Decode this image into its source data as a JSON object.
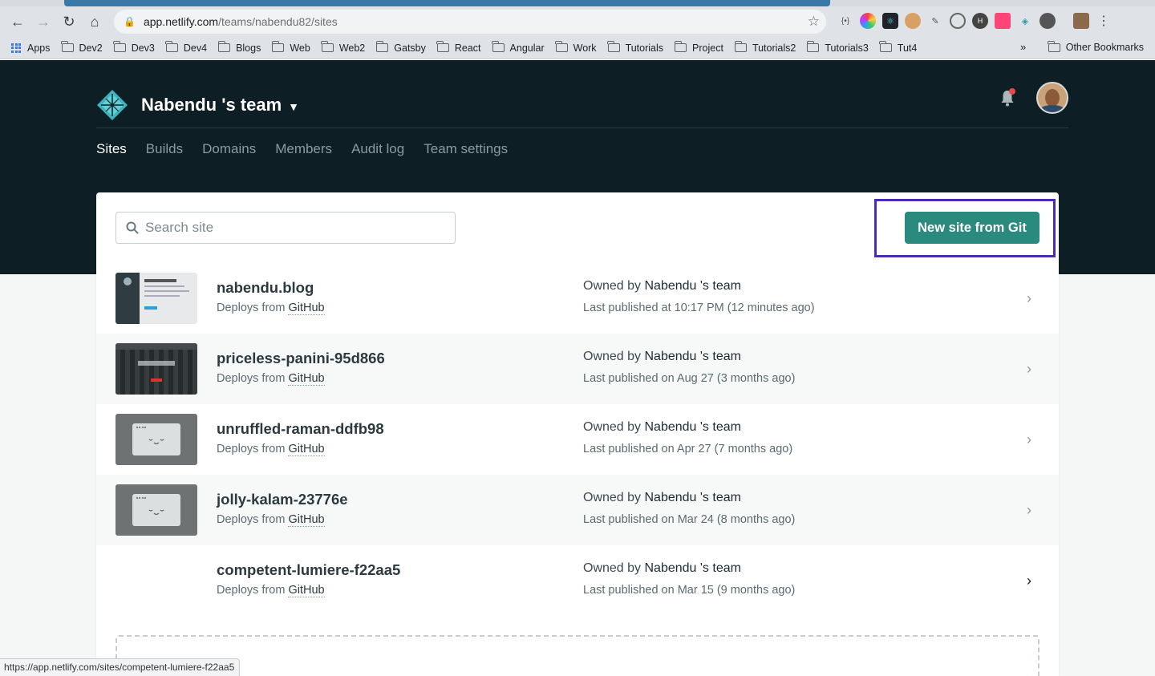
{
  "browser": {
    "url_host": "app.netlify.com",
    "url_path": "/teams/nabendu82/sites",
    "bookmarks": [
      "Dev2",
      "Dev3",
      "Dev4",
      "Blogs",
      "Web",
      "Web2",
      "Gatsby",
      "React",
      "Angular",
      "Work",
      "Tutorials",
      "Project",
      "Tutorials2",
      "Tutorials3",
      "Tut4"
    ],
    "apps_label": "Apps",
    "more_label": "»",
    "other_bookmarks": "Other Bookmarks",
    "status_url": "https://app.netlify.com/sites/competent-lumiere-f22aa5"
  },
  "header": {
    "team_name": "Nabendu 's team",
    "nav": [
      "Sites",
      "Builds",
      "Domains",
      "Members",
      "Audit log",
      "Team settings"
    ],
    "active_nav": "Sites"
  },
  "toolbar": {
    "search_placeholder": "Search site",
    "new_site_label": "New site from Git"
  },
  "sites": [
    {
      "name": "nabendu.blog",
      "deploy_prefix": "Deploys from ",
      "deploy_source": "GitHub",
      "owner_prefix": "Owned by ",
      "owner": "Nabendu 's team",
      "published": "Last published at 10:17 PM (12 minutes ago)",
      "thumb": "screenshot-blog"
    },
    {
      "name": "priceless-panini-95d866",
      "deploy_prefix": "Deploys from ",
      "deploy_source": "GitHub",
      "owner_prefix": "Owned by ",
      "owner": "Nabendu 's team",
      "published": "Last published on Aug 27 (3 months ago)",
      "thumb": "screenshot-dark"
    },
    {
      "name": "unruffled-raman-ddfb98",
      "deploy_prefix": "Deploys from ",
      "deploy_source": "GitHub",
      "owner_prefix": "Owned by ",
      "owner": "Nabendu 's team",
      "published": "Last published on Apr 27 (7 months ago)",
      "thumb": "placeholder"
    },
    {
      "name": "jolly-kalam-23776e",
      "deploy_prefix": "Deploys from ",
      "deploy_source": "GitHub",
      "owner_prefix": "Owned by ",
      "owner": "Nabendu 's team",
      "published": "Last published on Mar 24 (8 months ago)",
      "thumb": "placeholder"
    },
    {
      "name": "competent-lumiere-f22aa5",
      "deploy_prefix": "Deploys from ",
      "deploy_source": "GitHub",
      "owner_prefix": "Owned by ",
      "owner": "Nabendu 's team",
      "published": "Last published on Mar 15 (9 months ago)",
      "thumb": "none"
    }
  ],
  "colors": {
    "header_bg": "#0e1e25",
    "accent": "#2a8a7e",
    "highlight": "#4a2bb3"
  }
}
